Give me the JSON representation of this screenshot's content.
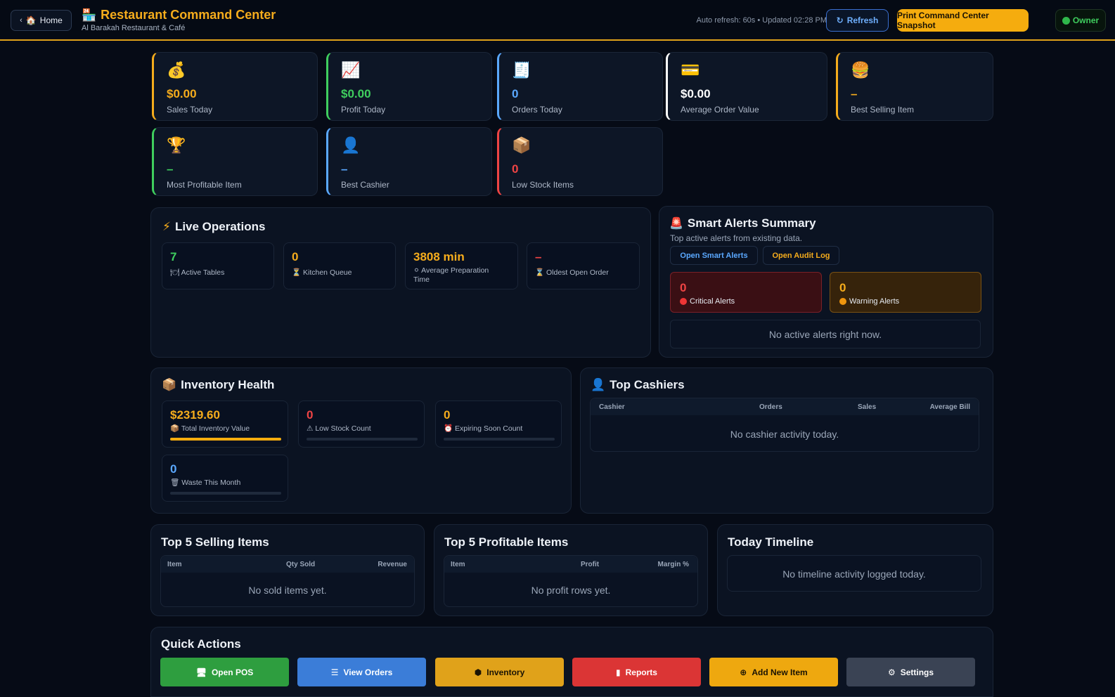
{
  "header": {
    "home_label": "Home",
    "title": "Restaurant Command Center",
    "subtitle": "Al Barakah Restaurant & Café",
    "auto_refresh": "Auto refresh: 60s • Updated 02:28 PM",
    "refresh_label": "Refresh",
    "print_label": "Print Command Center Snapshot",
    "role_label": "Owner"
  },
  "kpis": [
    {
      "icon": "money-bag-icon",
      "value": "$0.00",
      "label": "Sales Today",
      "color": "#f5ac1c"
    },
    {
      "icon": "chart-up-icon",
      "value": "$0.00",
      "label": "Profit Today",
      "color": "#3fce5e"
    },
    {
      "icon": "receipt-icon",
      "value": "0",
      "label": "Orders Today",
      "color": "#5aa8ff"
    },
    {
      "icon": "credit-card-icon",
      "value": "$0.00",
      "label": "Average Order Value",
      "color": "#ffffff"
    },
    {
      "icon": "burger-icon",
      "value": "–",
      "label": "Best Selling Item",
      "color": "#f5ac1c"
    },
    {
      "icon": "trophy-icon",
      "value": "–",
      "label": "Most Profitable Item",
      "color": "#3fce5e"
    },
    {
      "icon": "user-icon",
      "value": "–",
      "label": "Best Cashier",
      "color": "#5aa8ff"
    },
    {
      "icon": "package-icon",
      "value": "0",
      "label": "Low Stock Items",
      "color": "#ef4444"
    }
  ],
  "live_ops": {
    "title": "Live Operations",
    "stats": [
      {
        "value": "7",
        "label": "Active Tables",
        "color": "#3fce5e"
      },
      {
        "value": "0",
        "label": "Kitchen Queue",
        "color": "#f5ac1c"
      },
      {
        "value": "3808 min",
        "label": "Average Preparation Time",
        "color": "#f5ac1c"
      },
      {
        "value": "–",
        "label": "Oldest Open Order",
        "color": "#ef4444"
      }
    ]
  },
  "alerts": {
    "title": "Smart Alerts Summary",
    "subtitle": "Top active alerts from existing data.",
    "open_smart_label": "Open Smart Alerts",
    "open_audit_label": "Open Audit Log",
    "critical_value": "0",
    "critical_label": "Critical Alerts",
    "warning_value": "0",
    "warning_label": "Warning Alerts",
    "empty": "No active alerts right now."
  },
  "inventory": {
    "title": "Inventory Health",
    "stats": [
      {
        "value": "$2319.60",
        "label": "Total Inventory Value",
        "color": "#f5ac1c",
        "fill": 1.0
      },
      {
        "value": "0",
        "label": "Low Stock Count",
        "color": "#ef4444",
        "fill": 0
      },
      {
        "value": "0",
        "label": "Expiring Soon Count",
        "color": "#f5ac1c",
        "fill": 0
      },
      {
        "value": "0",
        "label": "Waste This Month",
        "color": "#5aa8ff",
        "fill": 0
      }
    ]
  },
  "cashiers": {
    "title": "Top Cashiers",
    "columns": [
      "Cashier",
      "Orders",
      "Sales",
      "Average Bill"
    ],
    "empty": "No cashier activity today."
  },
  "top_selling": {
    "title": "Top 5 Selling Items",
    "columns": [
      "Item",
      "Qty Sold",
      "Revenue"
    ],
    "empty": "No sold items yet."
  },
  "top_profitable": {
    "title": "Top 5 Profitable Items",
    "columns": [
      "Item",
      "Profit",
      "Margin %"
    ],
    "empty": "No profit rows yet."
  },
  "timeline": {
    "title": "Today Timeline",
    "empty": "No timeline activity logged today."
  },
  "quick_actions": {
    "title": "Quick Actions",
    "buttons": [
      {
        "label": "Open POS",
        "icon": "monitor-icon",
        "color": "#2e9e3f"
      },
      {
        "label": "View Orders",
        "icon": "list-icon",
        "color": "#3b7dd8"
      },
      {
        "label": "Inventory",
        "icon": "cube-icon",
        "color": "#e0a21a"
      },
      {
        "label": "Reports",
        "icon": "bar-chart-icon",
        "color": "#db3535"
      },
      {
        "label": "Add New Item",
        "icon": "plus-circle-icon",
        "color": "#eea80f"
      },
      {
        "label": "Settings",
        "icon": "gear-icon",
        "color": "#3a4354"
      }
    ]
  }
}
